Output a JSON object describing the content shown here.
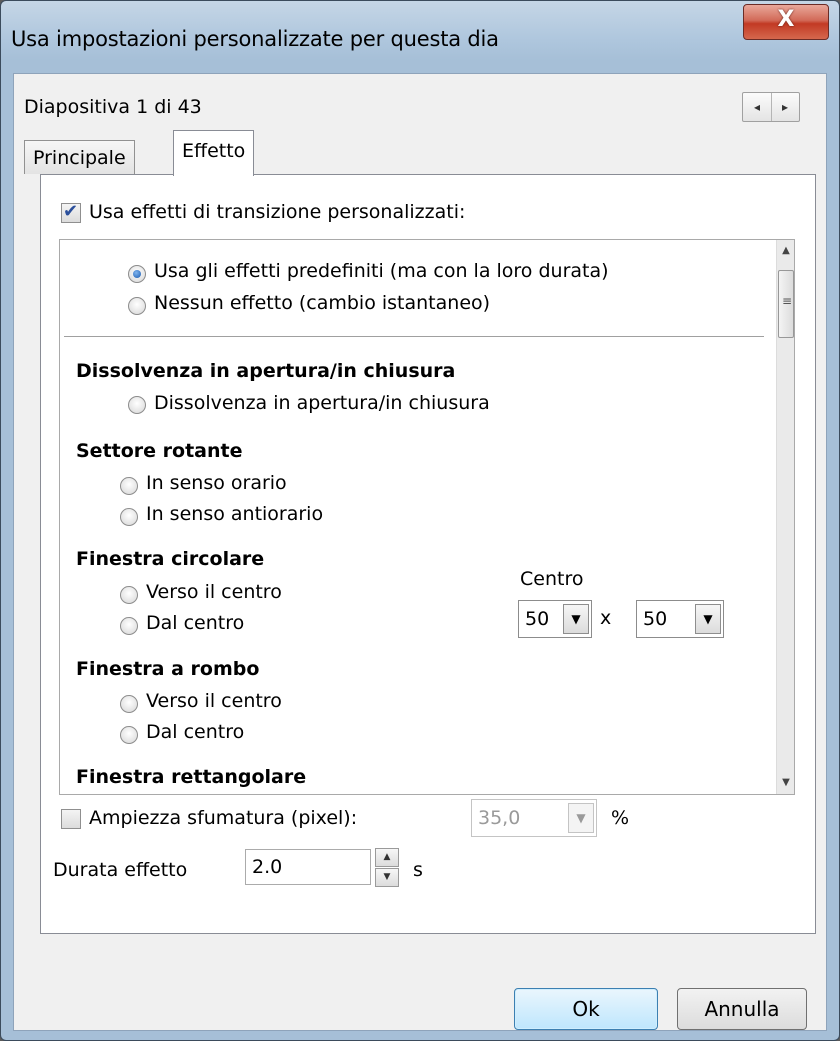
{
  "window": {
    "title": "Usa impostazioni personalizzate per questa dia",
    "close_label": "X"
  },
  "slide": {
    "position_label": "Diapositiva 1 di 43",
    "nav_prev": "◂",
    "nav_next": "▸"
  },
  "tabs": [
    {
      "label": "Principale",
      "active": false
    },
    {
      "label": "Effetto",
      "active": true
    }
  ],
  "custom_transitions": {
    "label": "Usa effetti di transizione personalizzati:",
    "checked": true
  },
  "effects_list": {
    "default_options": [
      {
        "label": "Usa gli effetti predefiniti (ma con la loro durata)",
        "selected": true
      },
      {
        "label": "Nessun effetto (cambio istantaneo)",
        "selected": false
      }
    ],
    "groups": [
      {
        "title": "Dissolvenza in apertura/in chiusura",
        "options": [
          "Dissolvenza in apertura/in chiusura"
        ]
      },
      {
        "title": "Settore rotante",
        "options": [
          "In senso orario",
          "In senso antiorario"
        ]
      },
      {
        "title": "Finestra circolare",
        "options": [
          "Verso il centro",
          "Dal centro"
        ]
      },
      {
        "title": "Finestra a rombo",
        "options": [
          "Verso il centro",
          "Dal centro"
        ]
      },
      {
        "title": "Finestra rettangolare",
        "options": []
      }
    ],
    "center": {
      "label": "Centro",
      "x_value": "50",
      "y_value": "50",
      "separator": "x"
    }
  },
  "feather": {
    "label": "Ampiezza sfumatura (pixel):",
    "checked": false,
    "value": "35,0",
    "unit": "%"
  },
  "duration": {
    "label": "Durata effetto",
    "value": "2.0",
    "unit": "s"
  },
  "buttons": {
    "ok": "Ok",
    "cancel": "Annulla"
  },
  "colors": {
    "title_bar": "#aec6dd",
    "close_button": "#c23a24",
    "ok_button": "#bee6fd",
    "radio_selected": "#1b5bb0"
  }
}
